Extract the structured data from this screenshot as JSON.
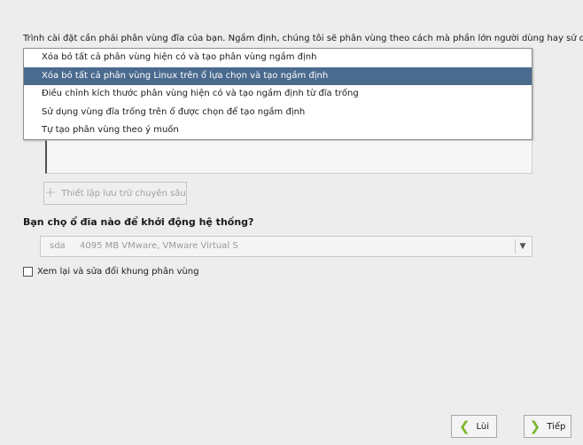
{
  "intro_text": "Trình cài đặt cần phải phân vùng đĩa của bạn. Ngầm định, chúng tôi sẽ phân vùng theo cách mà phần lớn người dùng hay sử dụng.",
  "partition_options": [
    {
      "label": "Xóa bỏ tất cả phân vùng hiện có và tạo phân vùng ngầm định",
      "selected": false
    },
    {
      "label": "Xóa bỏ tất cả phân vùng Linux trên ổ lựa chọn và tạo ngầm định",
      "selected": true
    },
    {
      "label": "Điều chỉnh kích thước phân vùng hiện có và tạo ngầm định từ đĩa trống",
      "selected": false
    },
    {
      "label": "Sử dụng vùng đĩa trống trên ổ được chọn để tạo ngầm định",
      "selected": false
    },
    {
      "label": "Tự tạo phân vùng theo ý muốn",
      "selected": false
    }
  ],
  "advanced_button": {
    "label": "Thiết lập lưu trữ chuyên sâu",
    "icon": "plus-icon"
  },
  "boot_question": "Bạn chọ ổ đĩa nào để khởi động hệ thống?",
  "boot_drive": {
    "name": "sda",
    "description": "4095 MB VMware, VMware Virtual S"
  },
  "review_checkbox": {
    "label": "Xem lại và sửa đổi khung phân vùng",
    "checked": false
  },
  "nav": {
    "back_label": "Lùi",
    "next_label": "Tiếp"
  },
  "colors": {
    "selection": "#4a6a8e",
    "arrow": "#7bb62b"
  }
}
